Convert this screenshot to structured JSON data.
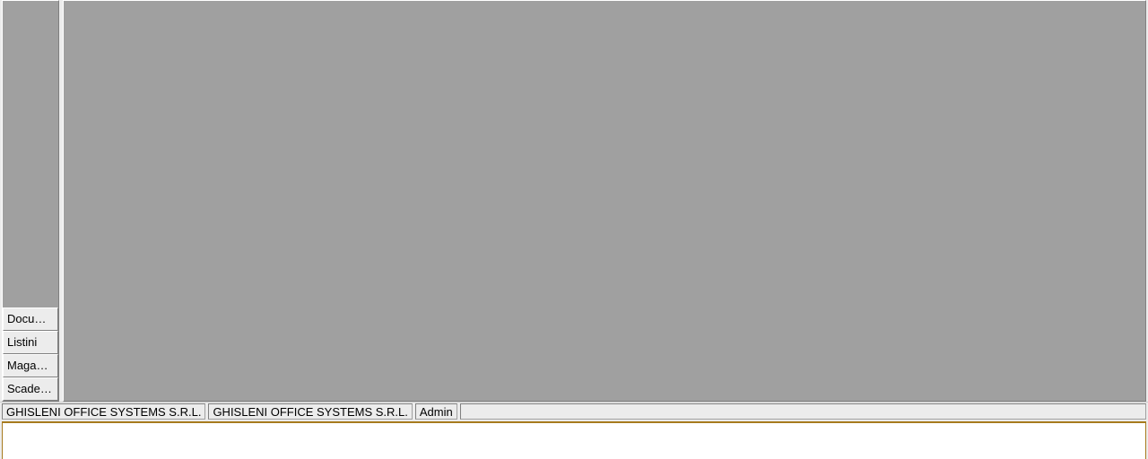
{
  "sidebar": {
    "items": [
      {
        "label": "Docu…"
      },
      {
        "label": "Listini"
      },
      {
        "label": "Maga…"
      },
      {
        "label": "Scade…"
      }
    ]
  },
  "statusbar": {
    "company1": "GHISLENI OFFICE SYSTEMS S.R.L.",
    "company2": "GHISLENI OFFICE SYSTEMS S.R.L.",
    "user": "Admin"
  }
}
